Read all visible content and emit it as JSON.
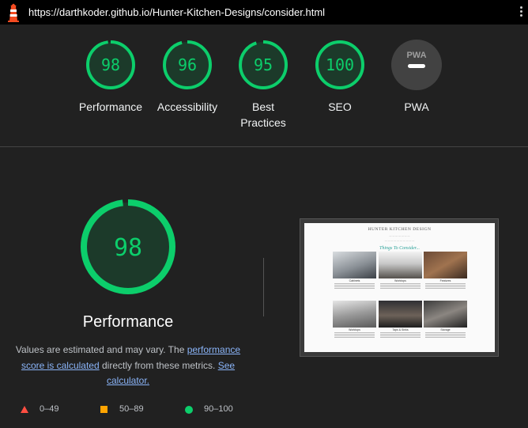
{
  "topbar": {
    "url": "https://darthkoder.github.io/Hunter-Kitchen-Designs/consider.html",
    "logo_icon": "lighthouse-icon",
    "menu_icon": "kebab-menu-icon"
  },
  "colors": {
    "pass": "#0cce6b",
    "average": "#ffa400",
    "fail": "#ff4e42",
    "pwa_gray": "#9e9e9e"
  },
  "categories": [
    {
      "label": "Performance",
      "score": 98
    },
    {
      "label": "Accessibility",
      "score": 96
    },
    {
      "label": "Best Practices",
      "score": 95
    },
    {
      "label": "SEO",
      "score": 100
    },
    {
      "label": "PWA",
      "badge": "PWA"
    }
  ],
  "main": {
    "score": 98,
    "title": "Performance",
    "desc_prefix": "Values are estimated and may vary. The ",
    "desc_link1": "performance score is calculated",
    "desc_middle": " directly from these metrics. ",
    "desc_link2": "See calculator."
  },
  "legend": [
    {
      "range": "0–49",
      "icon": "triangle-icon"
    },
    {
      "range": "50–89",
      "icon": "square-icon"
    },
    {
      "range": "90–100",
      "icon": "circle-icon"
    }
  ],
  "screenshot": {
    "brand": "HUNTER KITCHEN DESIGN",
    "heading": "Things To Consider...",
    "cards": [
      "Cabinets",
      "Worktops",
      "Features",
      "Worktops",
      "Taps & Sinks",
      "Storage"
    ]
  }
}
